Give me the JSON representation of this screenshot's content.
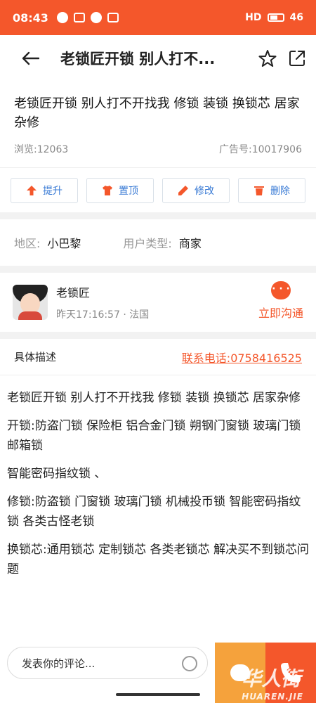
{
  "status_bar": {
    "time": "08:43",
    "battery": "46",
    "network": "HD"
  },
  "header": {
    "back_icon": "←",
    "title": "老锁匠开锁 别人打不..."
  },
  "post": {
    "title": "老锁匠开锁 别人打不开找我 修锁 装锁 换锁芯 居家杂修",
    "views": "浏览:12063",
    "ad_no": "广告号:10017906"
  },
  "actions": [
    {
      "label": "提升",
      "icon": "arrow-up-icon"
    },
    {
      "label": "置顶",
      "icon": "shirt-icon"
    },
    {
      "label": "修改",
      "icon": "pencil-icon"
    },
    {
      "label": "删除",
      "icon": "trash-icon"
    }
  ],
  "region": {
    "area_label": "地区:",
    "area_value": "小巴黎",
    "type_label": "用户类型:",
    "type_value": "商家"
  },
  "user": {
    "name": "老锁匠",
    "sub": "昨天17:16:57 · 法国",
    "chat_label": "立即沟通"
  },
  "description": {
    "heading": "具体描述",
    "phone_label": "联系电话:0758416525",
    "paragraphs": [
      "老锁匠开锁 别人打不开找我 修锁 装锁 换锁芯 居家杂修",
      "开锁:防盗门锁 保险柜 铝合金门锁 朔钢门窗锁 玻璃门锁 邮箱锁",
      "智能密码指纹锁 、",
      "修锁:防盗锁 门窗锁 玻璃门锁 机械投币锁 智能密码指纹锁 各类古怪老锁",
      "换锁芯:通用锁芯 定制锁芯 各类老锁芯 解决买不到锁芯问题"
    ]
  },
  "bottom": {
    "comment_placeholder": "发表你的评论..."
  },
  "watermark": {
    "text": "华人街",
    "sub": "HUAREN.JIE"
  },
  "colors": {
    "brand": "#f4572b",
    "accent_blue": "#3a7bd5",
    "chat_orange": "#f5a23c"
  }
}
